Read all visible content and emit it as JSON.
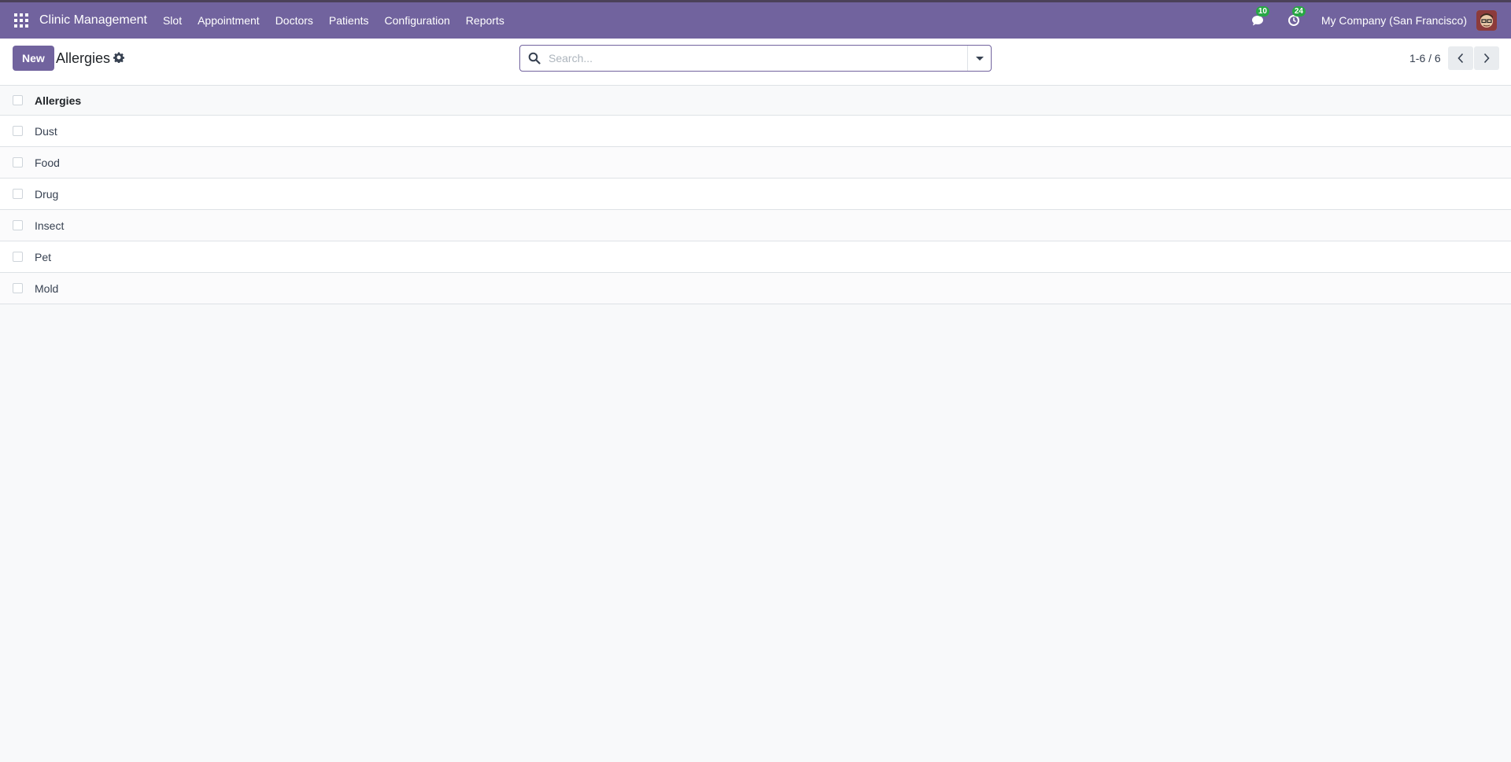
{
  "navbar": {
    "brand": "Clinic Management",
    "menu": [
      {
        "label": "Slot"
      },
      {
        "label": "Appointment"
      },
      {
        "label": "Doctors"
      },
      {
        "label": "Patients"
      },
      {
        "label": "Configuration"
      },
      {
        "label": "Reports"
      }
    ],
    "messages_badge": "10",
    "activities_badge": "24",
    "company": "My Company (San Francisco)",
    "bg_color": "#71639e"
  },
  "control_panel": {
    "new_label": "New",
    "title": "Allergies",
    "search_placeholder": "Search...",
    "pager": "1-6 / 6"
  },
  "list": {
    "column_header": "Allergies",
    "rows": [
      {
        "name": "Dust"
      },
      {
        "name": "Food"
      },
      {
        "name": "Drug"
      },
      {
        "name": "Insect"
      },
      {
        "name": "Pet"
      },
      {
        "name": "Mold"
      }
    ]
  }
}
